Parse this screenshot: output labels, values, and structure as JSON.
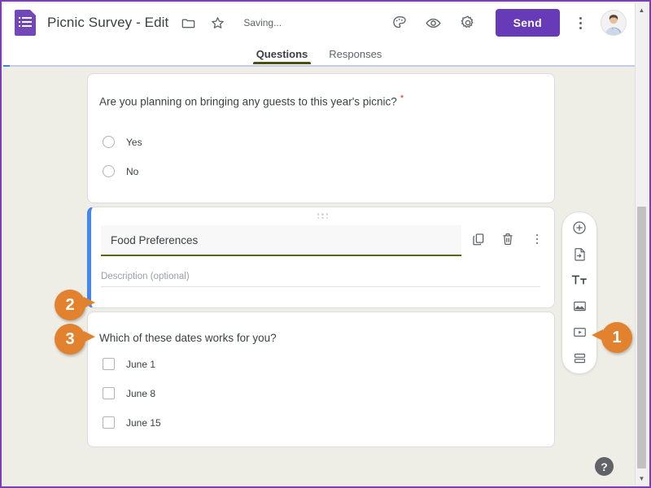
{
  "header": {
    "logo_icon": "google-forms-icon",
    "doc_title": "Picnic Survey - Edit",
    "folder_icon": "folder-icon",
    "star_icon": "star-icon",
    "save_status": "Saving...",
    "theme_icon": "palette-icon",
    "preview_icon": "eye-icon",
    "settings_icon": "gear-icon",
    "send_label": "Send",
    "more_icon": "kebab-menu-icon",
    "avatar_label": "account-avatar"
  },
  "tabs": [
    {
      "label": "Questions",
      "active": true
    },
    {
      "label": "Responses",
      "active": false
    }
  ],
  "questions": [
    {
      "id": "guests",
      "title": "Are you planning on bringing any guests to this year's picnic?",
      "required": true,
      "required_marker": "*",
      "type": "radio",
      "options": [
        "Yes",
        "No"
      ]
    },
    {
      "id": "food",
      "active": true,
      "title_value": "Food Preferences",
      "description_placeholder": "Description (optional)",
      "drag_handle": "drag-handle-icon",
      "actions": [
        {
          "name": "duplicate-icon",
          "label": "Duplicate"
        },
        {
          "name": "delete-icon",
          "label": "Delete"
        },
        {
          "name": "more-options-icon",
          "label": "More options"
        }
      ],
      "accent_color": "#4285f4",
      "underline_color": "#5f6411"
    },
    {
      "id": "dates",
      "title": "Which of these dates works for you?",
      "required": false,
      "type": "checkbox",
      "options": [
        "June 1",
        "June 8",
        "June 15"
      ]
    }
  ],
  "side_toolbar": [
    {
      "name": "add-question-icon",
      "label": "Add question"
    },
    {
      "name": "import-questions-icon",
      "label": "Import questions"
    },
    {
      "name": "add-title-description-icon",
      "label": "Add title and description"
    },
    {
      "name": "add-image-icon",
      "label": "Add image"
    },
    {
      "name": "add-video-icon",
      "label": "Add video"
    },
    {
      "name": "add-section-icon",
      "label": "Add section"
    }
  ],
  "callouts": [
    {
      "number": "1",
      "points": "left",
      "target": "add-title-description-icon"
    },
    {
      "number": "2",
      "points": "right",
      "target": "question-title-input"
    },
    {
      "number": "3",
      "points": "right",
      "target": "question-description-input"
    }
  ],
  "help": {
    "label": "?"
  },
  "scrollbar": {
    "up_arrow": "▲",
    "down_arrow": "▼"
  },
  "colors": {
    "brand_purple": "#673ab7",
    "accent_blue": "#4285f4",
    "olive": "#5f6411",
    "callout_orange": "#e2822e",
    "page_bg": "#eeeee6"
  }
}
